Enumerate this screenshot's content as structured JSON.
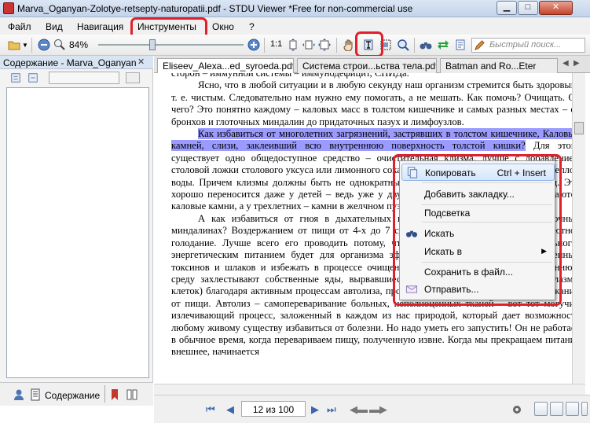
{
  "window": {
    "title": "Marva_Oganyan-Zolotye-retsepty-naturopatii.pdf - STDU Viewer *Free for non-commercial use",
    "minimize": "▁",
    "maximize": "□",
    "close": "✕"
  },
  "menu": [
    "Файл",
    "Вид",
    "Навигация",
    "Инструменты",
    "Окно",
    "?"
  ],
  "toolbar": {
    "zoom": "84%",
    "fit_label": "1:1",
    "search_placeholder": "Быстрый поиск..."
  },
  "left_panel": {
    "header": "Содержание - Marva_Oganyan",
    "bottom_tab": "Содержание"
  },
  "tabs": [
    "Eliseev_Alexa...ed_syroeda.pdf",
    "Система строи...ьства тела.pdf",
    "Batman and Ro...Eter"
  ],
  "document": {
    "line0": "сторон – иммунной системы – иммунодефицит, СПИДа.",
    "para1": "Ясно, что в любой ситуации и в любую секунду наш организм стремится быть здоровым, т. е. чистым. Следовательно нам нужно ему помогать, а не мешать. Как помочь? Очищать. От чего? Это понятно каждому – каловых масс в толстом кишечнике и самых разных местах – от бронхов и глоточных миндалин до придаточных пазух и лимфоузлов.",
    "selected": "Как избавиться от многолетних загрязнений, застрявших в толстом кишечнике, Каловых камней, слизи, заклеивший всю внутреннюю поверхность толстой кишки?",
    "para2_rest": "Для этого существует одно общедоступное средство – очистительная клизма, лучше с добавлением столовой ложки столового уксуса или лимонного сока на литр питьевой соды на 2 литра теплой воды. Причем клизмы должны быть не однократными, а повторными: 2–4 раза подряд. Это хорошо переносится даже у детей – ведь уже у двухлетних детей в кишечнике встречаются каловые камни, а у трехлетних – камни в желчном пузыре!",
    "para3": "А как избавиться от гноя в дыхательных путях, от гнойных пробок в глоточных миндалинах? Воздержанием от пищи от 4-х до 7 суток, а лучше – голоданием, абсолютное голодание. Лучше всего его проводить потому, что голодание тела (тем более больного) энергетическим питанием будет для организма эффективным избавляться от собственных токсинов и шлаков и избежать в процессе очищения аутоинтоксикации, когда внутреннюю среду захлестывают собственные яды, вырвавшиеся из клеточной «тюрьмы» (цитоплазмы клеток) благодаря активным процессам автолиза, происходящим в организме при воздержании от пищи. Автолиз – самопереваривание больных, неполноценных тканей – вот тот могучий излечивающий процесс, заложенный в каждом из нас природой, который дает возможность любому живому существу избавиться от болезни. Но надо уметь его запустить! Он не работает в обычное время, когда перевариваем пищу, полученную извне. Когда мы прекращаем питание внешнее, начинается"
  },
  "context_menu": {
    "copy": "Копировать",
    "copy_shortcut": "Ctrl + Insert",
    "bookmark": "Добавить закладку...",
    "highlight": "Подсветка",
    "search": "Искать",
    "search_in": "Искать в",
    "save": "Сохранить в файл...",
    "send": "Отправить..."
  },
  "nav": {
    "page": "12 из 100"
  },
  "colors": {
    "highlight_red": "#e0202a",
    "selection": "#9a9aff"
  }
}
